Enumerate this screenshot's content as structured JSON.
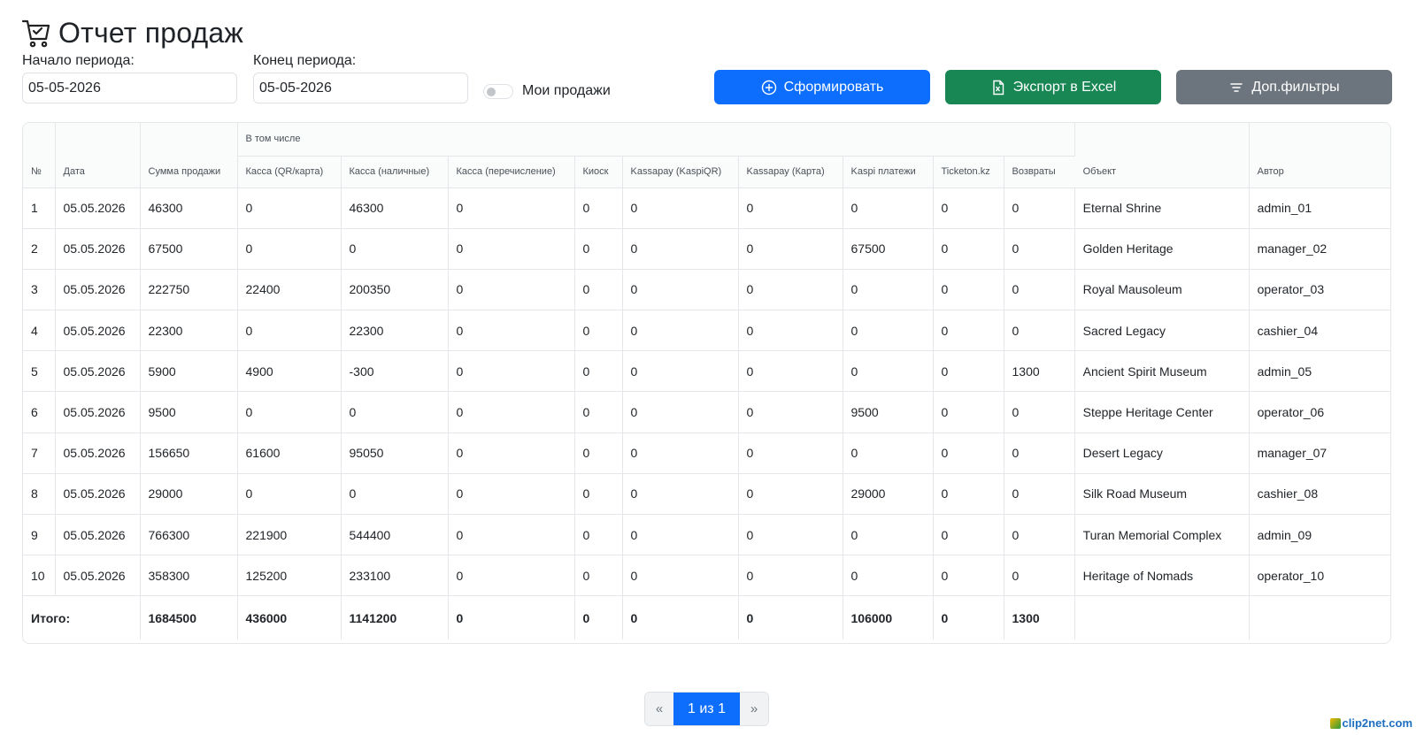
{
  "page": {
    "title": "Отчет продаж"
  },
  "filters": {
    "start_label": "Начало периода:",
    "start_value": "05-05-2026",
    "end_label": "Конец периода:",
    "end_value": "05-05-2026",
    "my_sales_label": "Мои продажи"
  },
  "buttons": {
    "generate": "Сформировать",
    "export": "Экспорт в Excel",
    "more_filters": "Доп.фильтры"
  },
  "colors": {
    "primary": "#0d6efd",
    "success": "#198754",
    "secondary": "#6c757d"
  },
  "table": {
    "headers": {
      "num": "№",
      "date": "Дата",
      "sum": "Сумма продажи",
      "group": "В том числе",
      "kassa_qr": "Касса (QR/карта)",
      "kassa_cash": "Касса (наличные)",
      "kassa_transfer": "Касса (перечисление)",
      "kiosk": "Киоск",
      "kassapay_qr": "Kassapay (KaspiQR)",
      "kassapay_card": "Kassapay (Карта)",
      "kaspi": "Kaspi платежи",
      "ticketon": "Ticketon.kz",
      "returns": "Возвраты",
      "object": "Объект",
      "author": "Автор"
    },
    "rows": [
      {
        "num": "1",
        "date": "05.05.2026",
        "sum": "46300",
        "kassa_qr": "0",
        "kassa_cash": "46300",
        "kassa_transfer": "0",
        "kiosk": "0",
        "kassapay_qr": "0",
        "kassapay_card": "0",
        "kaspi": "0",
        "ticketon": "0",
        "returns": "0",
        "object": "Eternal Shrine",
        "author": "admin_01"
      },
      {
        "num": "2",
        "date": "05.05.2026",
        "sum": "67500",
        "kassa_qr": "0",
        "kassa_cash": "0",
        "kassa_transfer": "0",
        "kiosk": "0",
        "kassapay_qr": "0",
        "kassapay_card": "0",
        "kaspi": "67500",
        "ticketon": "0",
        "returns": "0",
        "object": "Golden Heritage",
        "author": "manager_02"
      },
      {
        "num": "3",
        "date": "05.05.2026",
        "sum": "222750",
        "kassa_qr": "22400",
        "kassa_cash": "200350",
        "kassa_transfer": "0",
        "kiosk": "0",
        "kassapay_qr": "0",
        "kassapay_card": "0",
        "kaspi": "0",
        "ticketon": "0",
        "returns": "0",
        "object": "Royal Mausoleum",
        "author": "operator_03"
      },
      {
        "num": "4",
        "date": "05.05.2026",
        "sum": "22300",
        "kassa_qr": "0",
        "kassa_cash": "22300",
        "kassa_transfer": "0",
        "kiosk": "0",
        "kassapay_qr": "0",
        "kassapay_card": "0",
        "kaspi": "0",
        "ticketon": "0",
        "returns": "0",
        "object": "Sacred Legacy",
        "author": "cashier_04"
      },
      {
        "num": "5",
        "date": "05.05.2026",
        "sum": "5900",
        "kassa_qr": "4900",
        "kassa_cash": "-300",
        "kassa_transfer": "0",
        "kiosk": "0",
        "kassapay_qr": "0",
        "kassapay_card": "0",
        "kaspi": "0",
        "ticketon": "0",
        "returns": "1300",
        "object": "Ancient Spirit Museum",
        "author": "admin_05"
      },
      {
        "num": "6",
        "date": "05.05.2026",
        "sum": "9500",
        "kassa_qr": "0",
        "kassa_cash": "0",
        "kassa_transfer": "0",
        "kiosk": "0",
        "kassapay_qr": "0",
        "kassapay_card": "0",
        "kaspi": "9500",
        "ticketon": "0",
        "returns": "0",
        "object": "Steppe Heritage Center",
        "author": "operator_06"
      },
      {
        "num": "7",
        "date": "05.05.2026",
        "sum": "156650",
        "kassa_qr": "61600",
        "kassa_cash": "95050",
        "kassa_transfer": "0",
        "kiosk": "0",
        "kassapay_qr": "0",
        "kassapay_card": "0",
        "kaspi": "0",
        "ticketon": "0",
        "returns": "0",
        "object": "Desert Legacy",
        "author": "manager_07"
      },
      {
        "num": "8",
        "date": "05.05.2026",
        "sum": "29000",
        "kassa_qr": "0",
        "kassa_cash": "0",
        "kassa_transfer": "0",
        "kiosk": "0",
        "kassapay_qr": "0",
        "kassapay_card": "0",
        "kaspi": "29000",
        "ticketon": "0",
        "returns": "0",
        "object": "Silk Road Museum",
        "author": "cashier_08"
      },
      {
        "num": "9",
        "date": "05.05.2026",
        "sum": "766300",
        "kassa_qr": "221900",
        "kassa_cash": "544400",
        "kassa_transfer": "0",
        "kiosk": "0",
        "kassapay_qr": "0",
        "kassapay_card": "0",
        "kaspi": "0",
        "ticketon": "0",
        "returns": "0",
        "object": "Turan Memorial Complex",
        "author": "admin_09"
      },
      {
        "num": "10",
        "date": "05.05.2026",
        "sum": "358300",
        "kassa_qr": "125200",
        "kassa_cash": "233100",
        "kassa_transfer": "0",
        "kiosk": "0",
        "kassapay_qr": "0",
        "kassapay_card": "0",
        "kaspi": "0",
        "ticketon": "0",
        "returns": "0",
        "object": "Heritage of Nomads",
        "author": "operator_10"
      }
    ],
    "totals": {
      "label": "Итого:",
      "sum": "1684500",
      "kassa_qr": "436000",
      "kassa_cash": "1141200",
      "kassa_transfer": "0",
      "kiosk": "0",
      "kassapay_qr": "0",
      "kassapay_card": "0",
      "kaspi": "106000",
      "ticketon": "0",
      "returns": "1300"
    }
  },
  "pagination": {
    "prev": "«",
    "current": "1 из 1",
    "next": "»"
  },
  "watermark": {
    "text": "clip2net.com"
  }
}
